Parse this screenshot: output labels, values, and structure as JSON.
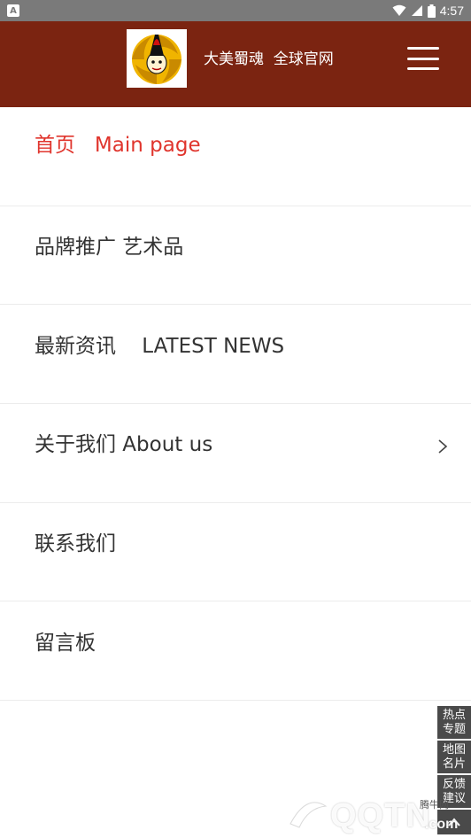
{
  "status_bar": {
    "time": "4:57"
  },
  "header": {
    "brand_title": "大美蜀魂  全球官网",
    "accent_color": "#7b2411"
  },
  "nav": {
    "items": [
      {
        "label": "首页   Main page",
        "active": true
      },
      {
        "label": "品牌推广 艺术品"
      },
      {
        "label": "最新资讯    LATEST NEWS"
      },
      {
        "label": "关于我们 About us",
        "has_chevron": true
      },
      {
        "label": "联系我们"
      },
      {
        "label": "留言板"
      }
    ],
    "active_color": "#e0352d"
  },
  "float_tools": {
    "hot_topics": "热点专题",
    "map_card": "地图名片",
    "feedback": "反馈建议"
  },
  "watermark": {
    "brand": "QQTN",
    "small_text": "腾牛网",
    "suffix": ".com"
  }
}
